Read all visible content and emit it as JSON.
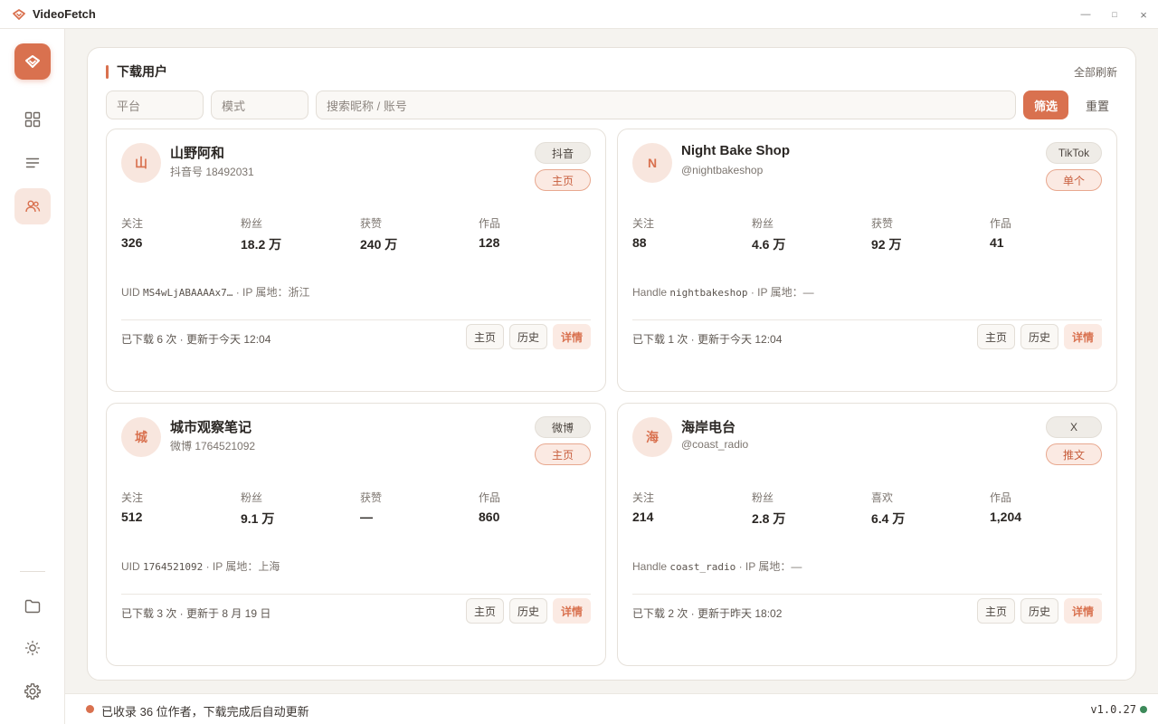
{
  "app": {
    "title": "VideoFetch"
  },
  "window_controls": {
    "minimize": "—",
    "maximize": "□",
    "close": "×"
  },
  "panel": {
    "title": "下载用户",
    "refresh_all": "全部刷新",
    "filters": {
      "platform_placeholder": "平台",
      "mode_placeholder": "模式",
      "search_placeholder": "搜索昵称 / 账号"
    },
    "filter_button": "筛选",
    "reset_button": "重置"
  },
  "cards": [
    {
      "avatar": "山",
      "name": "山野阿和",
      "account": "抖音号 18492031",
      "platform": "抖音",
      "mode": "主页",
      "stats": [
        {
          "label": "关注",
          "value": "326"
        },
        {
          "label": "粉丝",
          "value": "18.2 万"
        },
        {
          "label": "获赞",
          "value": "240 万"
        },
        {
          "label": "作品",
          "value": "128"
        }
      ],
      "meta_label": "UID",
      "meta_id": "MS4wLjABAAAAx7…",
      "meta_ip": "· IP 属地：浙江",
      "footer": "已下载 6 次 · 更新于今天 12:04",
      "btn_home": "主页",
      "btn_history": "历史",
      "btn_detail": "详情"
    },
    {
      "avatar": "N",
      "name": "Night Bake Shop",
      "account": "@nightbakeshop",
      "platform": "TikTok",
      "mode": "单个",
      "stats": [
        {
          "label": "关注",
          "value": "88"
        },
        {
          "label": "粉丝",
          "value": "4.6 万"
        },
        {
          "label": "获赞",
          "value": "92 万"
        },
        {
          "label": "作品",
          "value": "41"
        }
      ],
      "meta_label": "Handle",
      "meta_id": "nightbakeshop",
      "meta_ip": "· IP 属地：—",
      "footer": "已下载 1 次 · 更新于今天 12:04",
      "btn_home": "主页",
      "btn_history": "历史",
      "btn_detail": "详情"
    },
    {
      "avatar": "城",
      "name": "城市观察笔记",
      "account": "微博 1764521092",
      "platform": "微博",
      "mode": "主页",
      "stats": [
        {
          "label": "关注",
          "value": "512"
        },
        {
          "label": "粉丝",
          "value": "9.1 万"
        },
        {
          "label": "获赞",
          "value": "—"
        },
        {
          "label": "作品",
          "value": "860"
        }
      ],
      "meta_label": "UID",
      "meta_id": "1764521092",
      "meta_ip": "· IP 属地：上海",
      "footer": "已下载 3 次 · 更新于 8 月 19 日",
      "btn_home": "主页",
      "btn_history": "历史",
      "btn_detail": "详情"
    },
    {
      "avatar": "海",
      "name": "海岸电台",
      "account": "@coast_radio",
      "platform": "X",
      "mode": "推文",
      "stats": [
        {
          "label": "关注",
          "value": "214"
        },
        {
          "label": "粉丝",
          "value": "2.8 万"
        },
        {
          "label": "喜欢",
          "value": "6.4 万"
        },
        {
          "label": "作品",
          "value": "1,204"
        }
      ],
      "meta_label": "Handle",
      "meta_id": "coast_radio",
      "meta_ip": "· IP 属地：—",
      "footer": "已下载 2 次 · 更新于昨天 18:02",
      "btn_home": "主页",
      "btn_history": "历史",
      "btn_detail": "详情"
    }
  ],
  "status": {
    "text": "已收录 36 位作者，下载完成后自动更新",
    "version": "v1.0.27"
  },
  "colors": {
    "accent": "#d9714f",
    "accent_soft": "#f8e6de",
    "online": "#3d8a5a"
  }
}
